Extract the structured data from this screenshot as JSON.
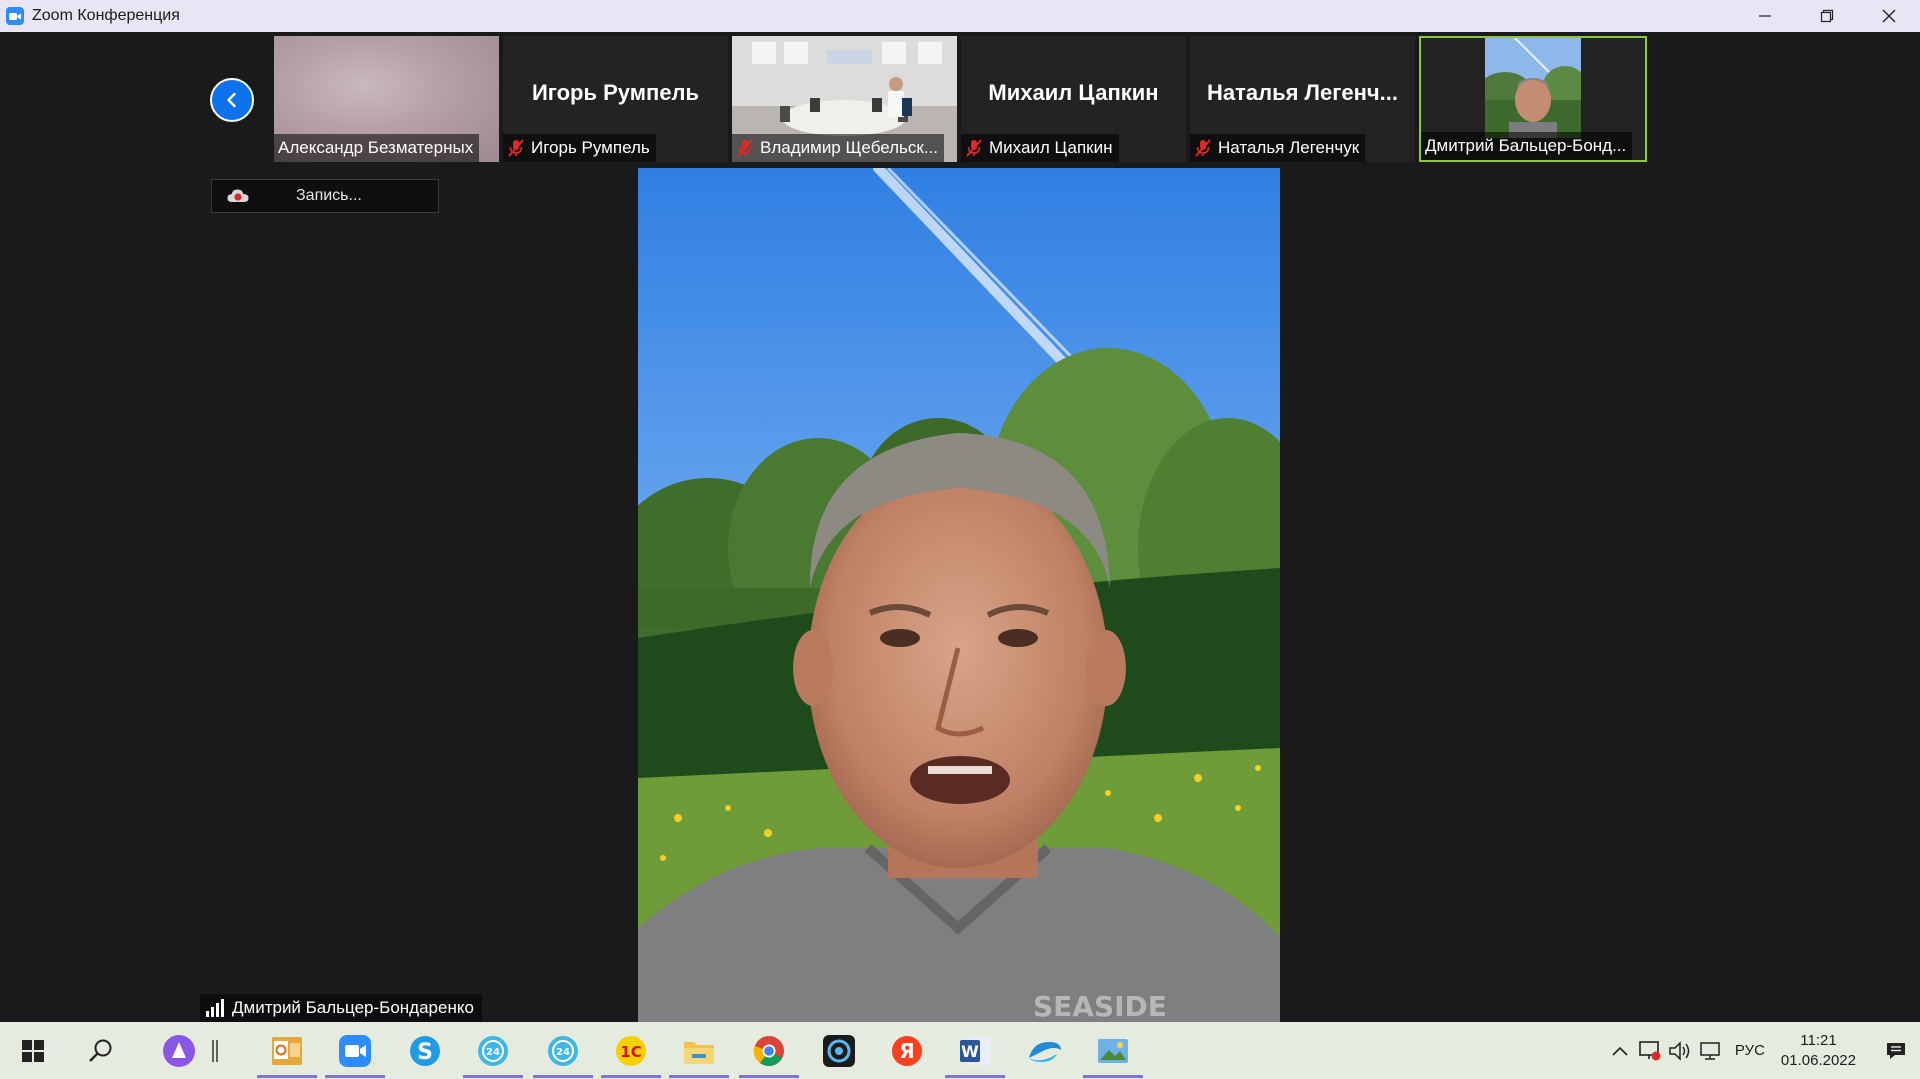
{
  "window": {
    "title": "Zoom Конференция",
    "icon": "zoom-camera-icon"
  },
  "colors": {
    "accent": "#0e72ed",
    "active_border": "#8dc63f",
    "muted_red": "#e02828",
    "background": "#1a1a1a"
  },
  "participants": [
    {
      "name": "Александр Безматерных",
      "display_name": "",
      "muted": false,
      "video": "blurred"
    },
    {
      "name": "Игорь Румпель",
      "display_name": "Игорь Румпель",
      "muted": true,
      "video": "off"
    },
    {
      "name": "Владимир Щебельск...",
      "display_name": "",
      "muted": true,
      "video": "office"
    },
    {
      "name": "Михаил Цапкин",
      "display_name": "Михаил Цапкин",
      "muted": true,
      "video": "off"
    },
    {
      "name": "Наталья Легенчук",
      "display_name": "Наталья  Легенч...",
      "muted": true,
      "video": "off"
    },
    {
      "name": "Дмитрий Бальцер-Бонд...",
      "display_name": "",
      "muted": false,
      "video": "self",
      "active": true
    }
  ],
  "recording": {
    "label": "Запись..."
  },
  "active_speaker": {
    "name": "Дмитрий Бальцер-Бондаренко",
    "shirt_text": "SEASIDE"
  },
  "taskbar": {
    "apps": [
      "windows-start-icon",
      "search-icon",
      "alice-icon",
      "divider",
      "outlook-icon",
      "zoom-icon",
      "skype-icon",
      "bitrix24-icon",
      "bitrix24-icon",
      "1c-icon",
      "file-explorer-icon",
      "chrome-icon",
      "camera-icon",
      "yandex-icon",
      "word-icon",
      "edge-icon",
      "image-viewer-icon"
    ],
    "lang": "РУС",
    "time": "11:21",
    "date": "01.06.2022"
  }
}
